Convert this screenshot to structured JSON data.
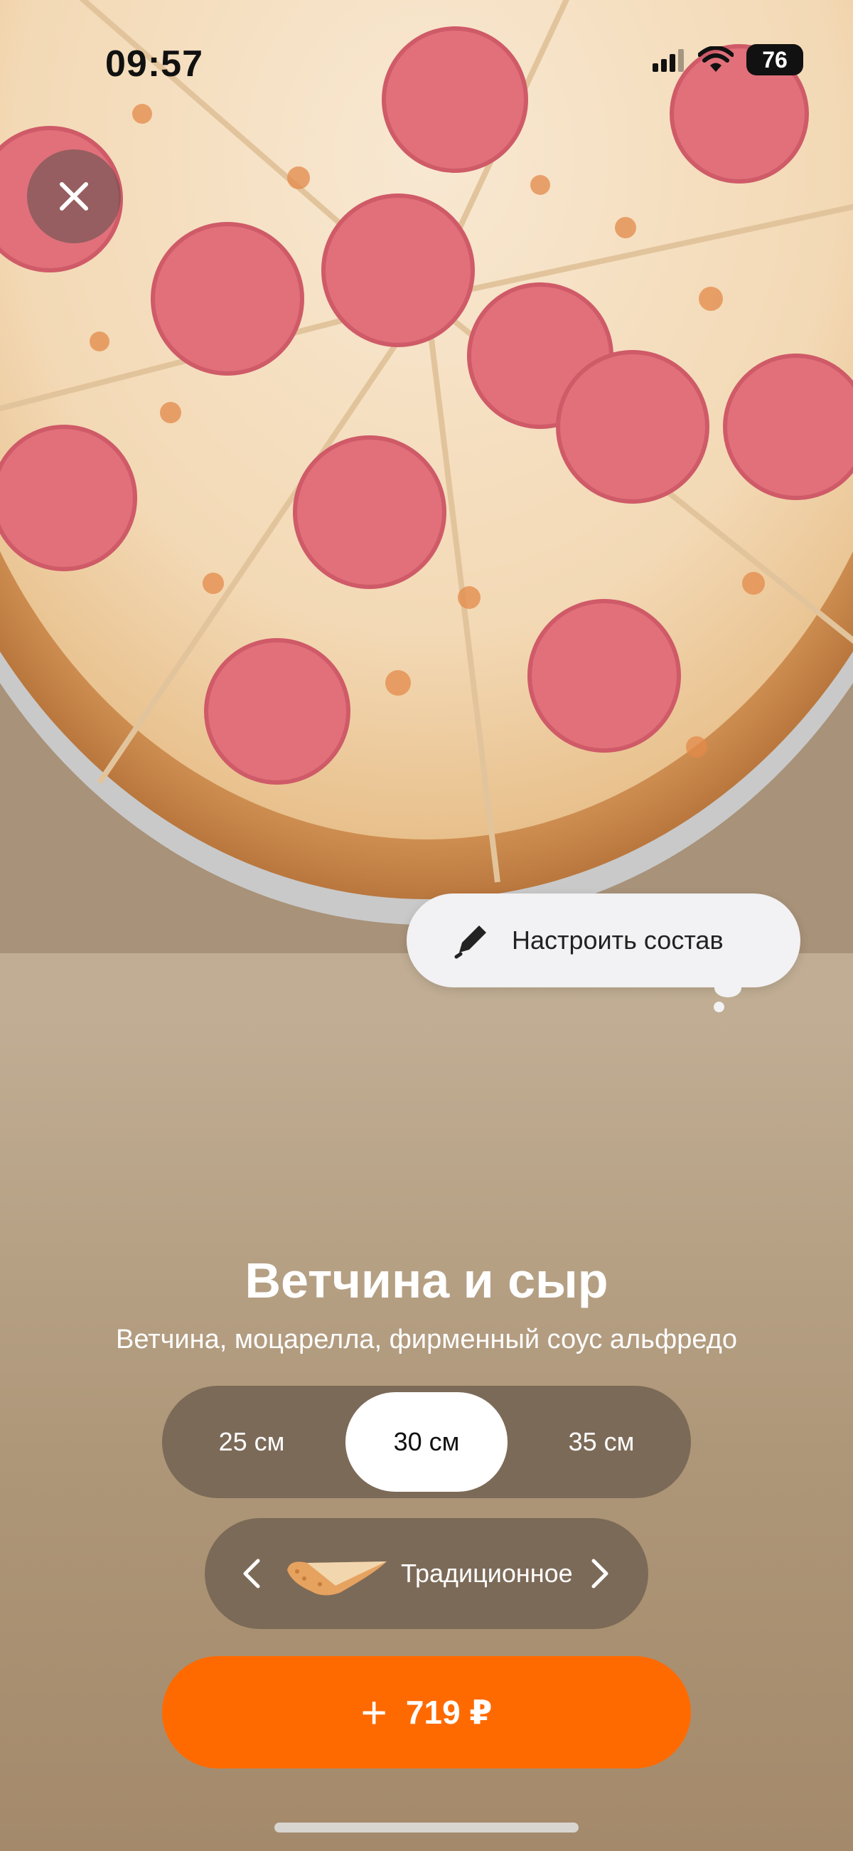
{
  "status_bar": {
    "time": "09:57",
    "battery": "76"
  },
  "icons": {
    "close": "close-icon",
    "pencil": "pencil-icon",
    "prev": "chevron-left-icon",
    "next": "chevron-right-icon",
    "plus": "plus-icon"
  },
  "customize": {
    "label": "Настроить состав"
  },
  "product": {
    "title": "Ветчина и сыр",
    "description": "Ветчина, моцарелла, фирменный соус альфредо"
  },
  "sizes": {
    "options": [
      "25 см",
      "30 см",
      "35 см"
    ],
    "selected": "30 см"
  },
  "dough": {
    "label": "Традиционное"
  },
  "add_button": {
    "plus": "+",
    "price": "719 ₽"
  },
  "colors": {
    "accent": "#ff6a00",
    "selector_bg": "#7c6a58"
  }
}
